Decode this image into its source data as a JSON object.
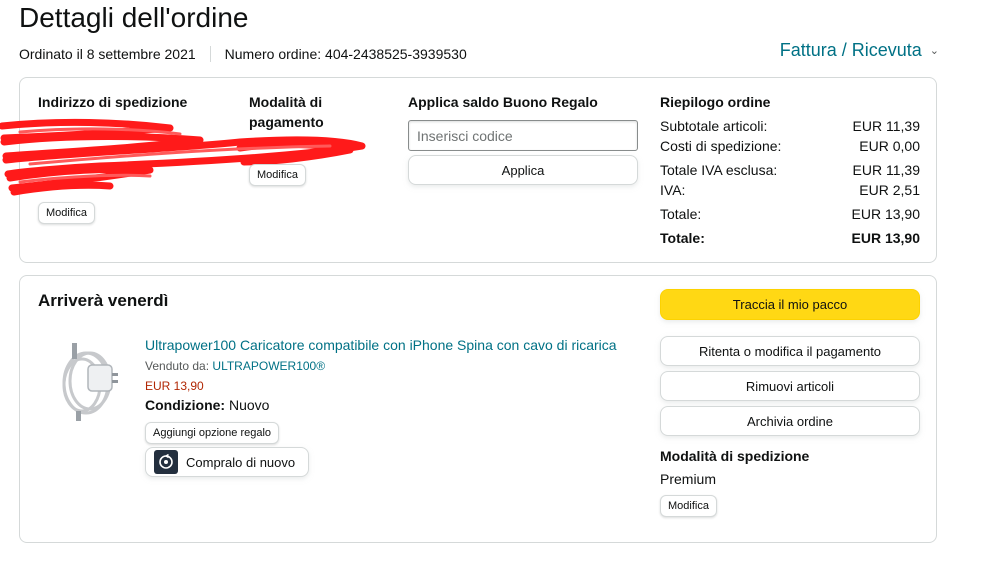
{
  "page": {
    "title": "Dettagli dell'ordine",
    "ordered_on": "Ordinato il 8 settembre 2021",
    "order_number": "Numero ordine: 404-2438525-3939530",
    "invoice_link": "Fattura / Ricevuta"
  },
  "order_info": {
    "shipping_address_label": "Indirizzo di spedizione",
    "shipping_edit": "Modifica",
    "payment_label": "Modalità di pagamento",
    "payment_edit": "Modifica",
    "gift_label": "Applica saldo Buono Regalo",
    "gift_placeholder": "Inserisci codice",
    "gift_apply": "Applica"
  },
  "summary": {
    "title": "Riepilogo ordine",
    "rows": [
      {
        "label": "Subtotale articoli:",
        "value": "EUR 11,39"
      },
      {
        "label": "Costi di spedizione:",
        "value": "EUR 0,00"
      },
      {
        "label": "Totale IVA esclusa:",
        "value": "EUR 11,39"
      },
      {
        "label": "IVA:",
        "value": "EUR 2,51"
      },
      {
        "label": "Totale:",
        "value": "EUR 13,90"
      }
    ],
    "grand_total_label": "Totale:",
    "grand_total_value": "EUR 13,90"
  },
  "shipment": {
    "status": "Arriverà venerdì",
    "product_title": "Ultrapower100 Caricatore compatibile con iPhone Spina con cavo di ricarica",
    "sold_by_label": "Venduto da:",
    "seller": "ULTRAPOWER100®",
    "price": "EUR 13,90",
    "condition_label": "Condizione:",
    "condition_value": "Nuovo",
    "gift_option": "Aggiungi opzione regalo",
    "buy_again": "Compralo di nuovo",
    "actions": {
      "track": "Traccia il mio pacco",
      "retry_payment": "Ritenta o modifica il pagamento",
      "remove_items": "Rimuovi articoli",
      "archive": "Archivia ordine"
    },
    "shipping_method_label": "Modalità di spedizione",
    "shipping_method_value": "Premium",
    "shipping_method_edit": "Modifica"
  },
  "colors": {
    "link": "#007185",
    "price": "#b12704",
    "primary_button": "#ffd814",
    "redaction": "#ff0000"
  }
}
